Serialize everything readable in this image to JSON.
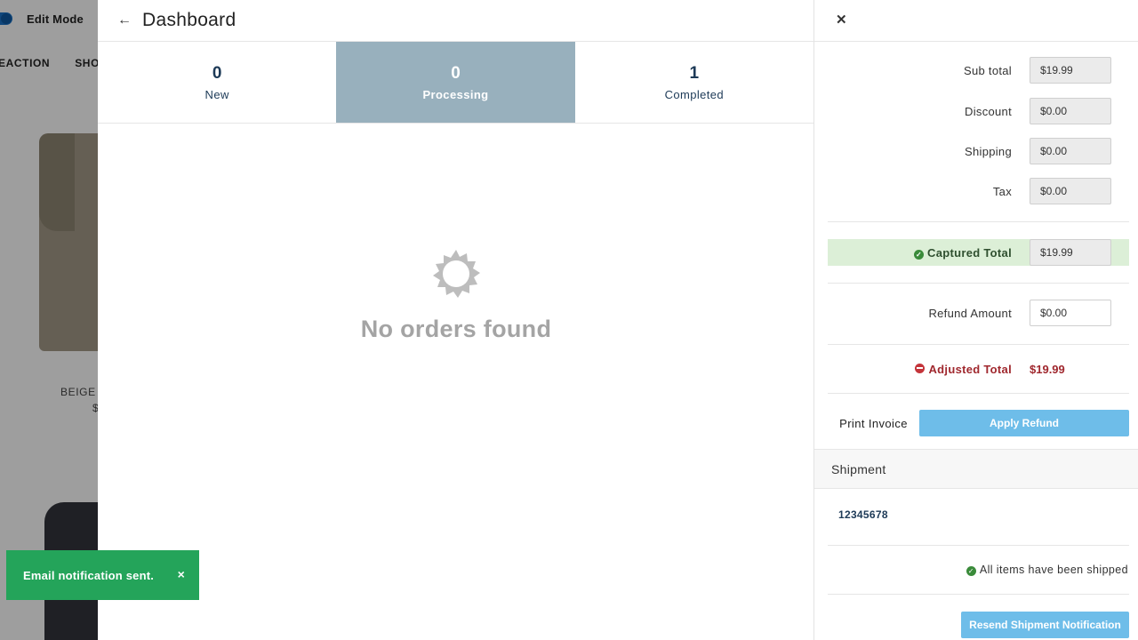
{
  "background": {
    "edit_mode_label": "Edit Mode",
    "nav": [
      "EACTION",
      "SHOR"
    ],
    "product_name": "BEIGE",
    "product_price": "$"
  },
  "dashboard": {
    "title": "Dashboard",
    "tabs": [
      {
        "count": "0",
        "label": "New",
        "active": false
      },
      {
        "count": "0",
        "label": "Processing",
        "active": true
      },
      {
        "count": "1",
        "label": "Completed",
        "active": false
      }
    ],
    "empty_message": "No orders found"
  },
  "detail": {
    "subtotal_label": "Sub total",
    "subtotal_value": "$19.99",
    "discount_label": "Discount",
    "discount_value": "$0.00",
    "shipping_label": "Shipping",
    "shipping_value": "$0.00",
    "tax_label": "Tax",
    "tax_value": "$0.00",
    "captured_label": "Captured Total",
    "captured_value": "$19.99",
    "refund_label": "Refund Amount",
    "refund_value": "$0.00",
    "adjusted_label": "Adjusted Total",
    "adjusted_value": "$19.99",
    "print_invoice": "Print Invoice",
    "apply_refund": "Apply Refund",
    "shipment_header": "Shipment",
    "tracking_number": "12345678",
    "shipped_status": "All items have been shipped",
    "resend_button": "Resend Shipment Notification"
  },
  "toast": {
    "message": "Email notification sent.",
    "close": "×"
  },
  "colors": {
    "active_tab": "#98b0bd",
    "primary_button": "#6ebde9",
    "toast": "#24a45a",
    "captured_bg": "#dcefd7",
    "adjusted_text": "#a0282e"
  }
}
